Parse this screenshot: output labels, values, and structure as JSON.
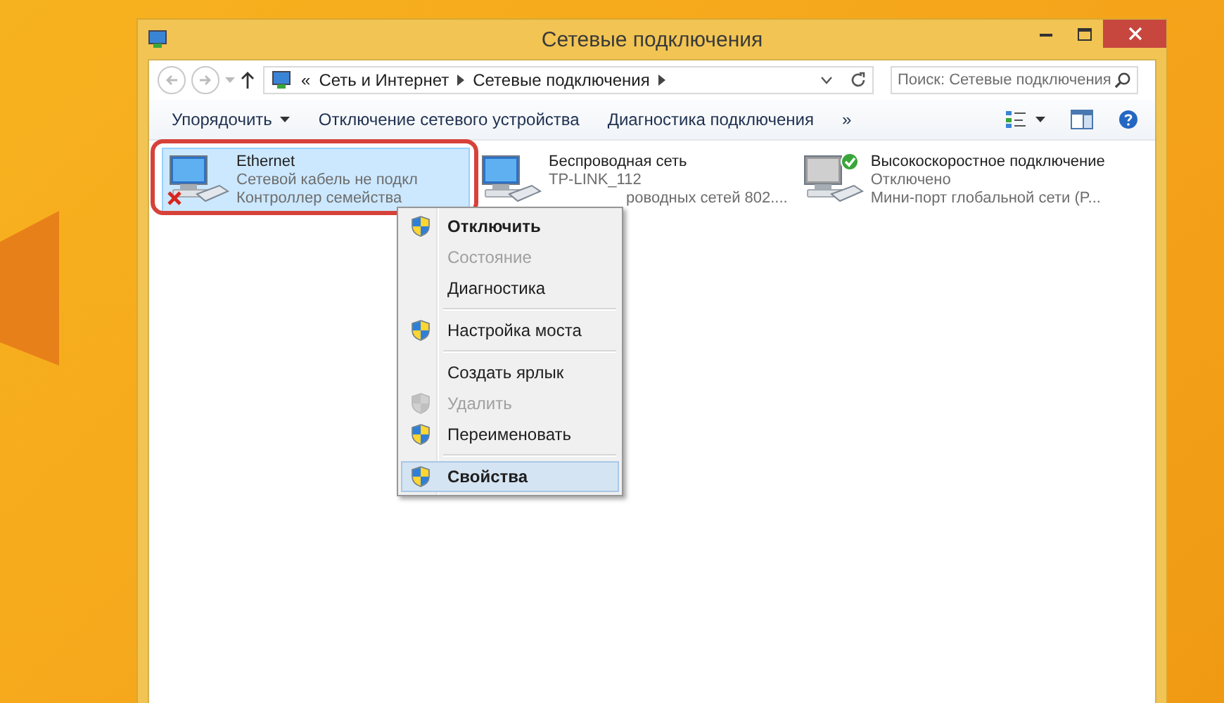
{
  "window": {
    "title": "Сетевые подключения"
  },
  "address_bar": {
    "overflow": "«",
    "crumbs": [
      "Сеть и Интернет",
      "Сетевые подключения"
    ]
  },
  "search": {
    "placeholder": "Поиск: Сетевые подключения"
  },
  "toolbar": {
    "buttons": [
      {
        "label": "Упорядочить",
        "dropdown": true
      },
      {
        "label": "Отключение сетевого устройства",
        "dropdown": false
      },
      {
        "label": "Диагностика подключения",
        "dropdown": false
      }
    ],
    "more": "»"
  },
  "connections": [
    {
      "name": "Ethernet",
      "kind": "error",
      "selected": true,
      "annotated": true,
      "lines": [
        {
          "text": "Сетевой кабель не подкл",
          "kind": "full"
        },
        {
          "text": "Контроллер семейства",
          "kind": "full"
        }
      ]
    },
    {
      "name": "Беспроводная сеть",
      "kind": "plain",
      "selected": false,
      "annotated": false,
      "lines": [
        {
          "text": "TP-LINK_112",
          "kind": "full"
        },
        {
          "text": "роводных сетей 802....",
          "kind": "tail"
        }
      ]
    },
    {
      "name": "Высокоскоростное подключение",
      "kind": "ok",
      "selected": false,
      "annotated": false,
      "lines": [
        {
          "text": "Отключено",
          "kind": "full"
        },
        {
          "text": "Мини-порт глобальной сети (P...",
          "kind": "full"
        }
      ]
    }
  ],
  "context_menu": [
    {
      "kind": "item",
      "label": "Отключить",
      "shield": true,
      "bold": true,
      "disabled": false,
      "selected": false
    },
    {
      "kind": "item",
      "label": "Состояние",
      "shield": false,
      "bold": false,
      "disabled": true,
      "selected": false
    },
    {
      "kind": "item",
      "label": "Диагностика",
      "shield": false,
      "bold": false,
      "disabled": false,
      "selected": false
    },
    {
      "kind": "separator"
    },
    {
      "kind": "item",
      "label": "Настройка моста",
      "shield": true,
      "bold": false,
      "disabled": false,
      "selected": false
    },
    {
      "kind": "separator"
    },
    {
      "kind": "item",
      "label": "Создать ярлык",
      "shield": false,
      "bold": false,
      "disabled": false,
      "selected": false
    },
    {
      "kind": "item",
      "label": "Удалить",
      "shield": true,
      "bold": false,
      "disabled": true,
      "selected": false
    },
    {
      "kind": "item",
      "label": "Переименовать",
      "shield": true,
      "bold": false,
      "disabled": false,
      "selected": false
    },
    {
      "kind": "separator"
    },
    {
      "kind": "item",
      "label": "Свойства",
      "shield": true,
      "bold": true,
      "disabled": false,
      "selected": true
    }
  ]
}
